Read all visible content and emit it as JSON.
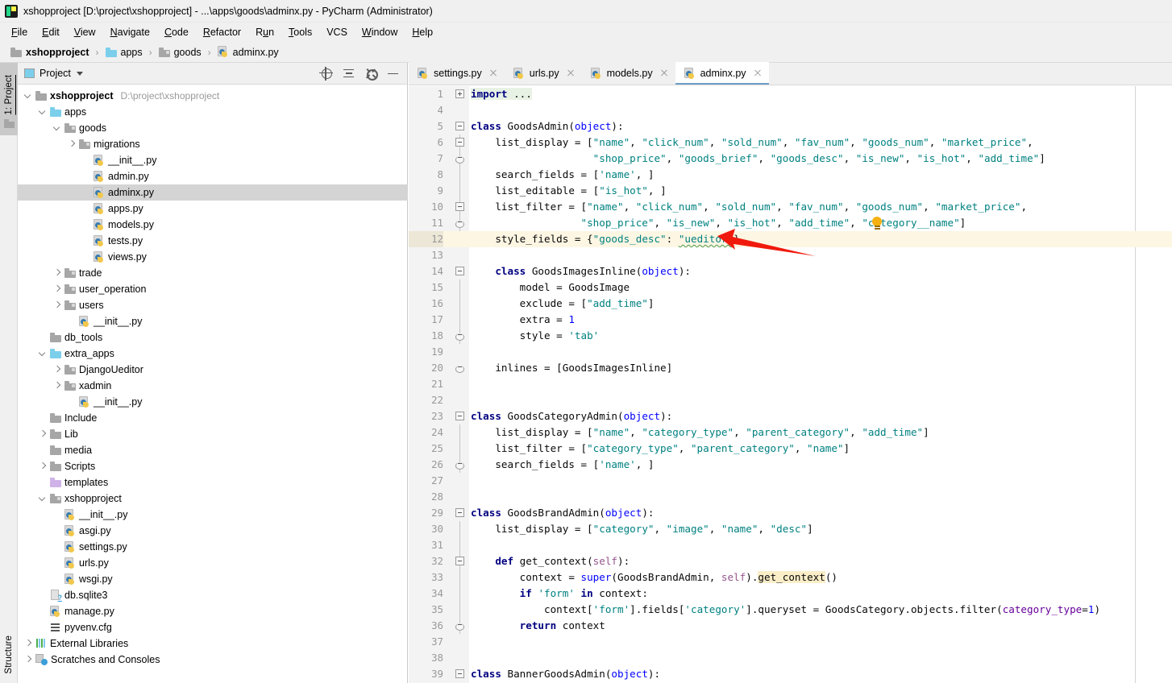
{
  "window": {
    "title": "xshopproject [D:\\project\\xshopproject] - ...\\apps\\goods\\adminx.py - PyCharm (Administrator)",
    "app_icon": "pycharm-logo-icon"
  },
  "menubar": {
    "items": [
      {
        "label": "File",
        "mnemonic": "F"
      },
      {
        "label": "Edit",
        "mnemonic": "E"
      },
      {
        "label": "View",
        "mnemonic": "V"
      },
      {
        "label": "Navigate",
        "mnemonic": "N"
      },
      {
        "label": "Code",
        "mnemonic": "C"
      },
      {
        "label": "Refactor",
        "mnemonic": "R"
      },
      {
        "label": "Run",
        "mnemonic": "u"
      },
      {
        "label": "Tools",
        "mnemonic": "T"
      },
      {
        "label": "VCS",
        "mnemonic": ""
      },
      {
        "label": "Window",
        "mnemonic": "W"
      },
      {
        "label": "Help",
        "mnemonic": "H"
      }
    ]
  },
  "breadcrumb": {
    "items": [
      {
        "label": "xshopproject",
        "icon": "folder-icon",
        "bold": true
      },
      {
        "label": "apps",
        "icon": "folder-blue-icon",
        "bold": false
      },
      {
        "label": "goods",
        "icon": "folder-source-icon",
        "bold": false
      },
      {
        "label": "adminx.py",
        "icon": "python-file-icon",
        "bold": false
      }
    ],
    "separator": "›"
  },
  "left_toolstrip": {
    "project_tab": "1: Project",
    "structure_tab": "Structure"
  },
  "project_panel": {
    "title": "Project",
    "actions": [
      {
        "name": "select-opened-file-icon",
        "label": "Select Opened File"
      },
      {
        "name": "collapse-all-icon",
        "label": "Collapse All"
      },
      {
        "name": "settings-gear-icon",
        "label": "Settings"
      },
      {
        "name": "hide-panel-icon",
        "label": "Hide"
      }
    ],
    "tree": [
      {
        "indent": 0,
        "arrow": "down",
        "icon": "folder-icon",
        "label": "xshopproject",
        "bold": true,
        "sub": "D:\\project\\xshopproject",
        "selected": false
      },
      {
        "indent": 1,
        "arrow": "down",
        "icon": "folder-blue-icon",
        "label": "apps",
        "bold": false,
        "sub": "",
        "selected": false
      },
      {
        "indent": 2,
        "arrow": "down",
        "icon": "folder-source-icon",
        "label": "goods",
        "bold": false,
        "sub": "",
        "selected": false
      },
      {
        "indent": 3,
        "arrow": "right",
        "icon": "folder-source-icon",
        "label": "migrations",
        "bold": false,
        "sub": "",
        "selected": false
      },
      {
        "indent": 4,
        "arrow": "none",
        "icon": "python-file-icon",
        "label": "__init__.py",
        "bold": false,
        "sub": "",
        "selected": false
      },
      {
        "indent": 4,
        "arrow": "none",
        "icon": "python-file-icon",
        "label": "admin.py",
        "bold": false,
        "sub": "",
        "selected": false
      },
      {
        "indent": 4,
        "arrow": "none",
        "icon": "python-file-icon",
        "label": "adminx.py",
        "bold": false,
        "sub": "",
        "selected": true
      },
      {
        "indent": 4,
        "arrow": "none",
        "icon": "python-file-icon",
        "label": "apps.py",
        "bold": false,
        "sub": "",
        "selected": false
      },
      {
        "indent": 4,
        "arrow": "none",
        "icon": "python-file-icon",
        "label": "models.py",
        "bold": false,
        "sub": "",
        "selected": false
      },
      {
        "indent": 4,
        "arrow": "none",
        "icon": "python-file-icon",
        "label": "tests.py",
        "bold": false,
        "sub": "",
        "selected": false
      },
      {
        "indent": 4,
        "arrow": "none",
        "icon": "python-file-icon",
        "label": "views.py",
        "bold": false,
        "sub": "",
        "selected": false
      },
      {
        "indent": 2,
        "arrow": "right",
        "icon": "folder-source-icon",
        "label": "trade",
        "bold": false,
        "sub": "",
        "selected": false
      },
      {
        "indent": 2,
        "arrow": "right",
        "icon": "folder-source-icon",
        "label": "user_operation",
        "bold": false,
        "sub": "",
        "selected": false
      },
      {
        "indent": 2,
        "arrow": "right",
        "icon": "folder-source-icon",
        "label": "users",
        "bold": false,
        "sub": "",
        "selected": false
      },
      {
        "indent": 3,
        "arrow": "none",
        "icon": "python-file-icon",
        "label": "__init__.py",
        "bold": false,
        "sub": "",
        "selected": false
      },
      {
        "indent": 1,
        "arrow": "none",
        "icon": "folder-icon",
        "label": "db_tools",
        "bold": false,
        "sub": "",
        "selected": false
      },
      {
        "indent": 1,
        "arrow": "down",
        "icon": "folder-blue-icon",
        "label": "extra_apps",
        "bold": false,
        "sub": "",
        "selected": false
      },
      {
        "indent": 2,
        "arrow": "right",
        "icon": "folder-source-icon",
        "label": "DjangoUeditor",
        "bold": false,
        "sub": "",
        "selected": false
      },
      {
        "indent": 2,
        "arrow": "right",
        "icon": "folder-source-icon",
        "label": "xadmin",
        "bold": false,
        "sub": "",
        "selected": false
      },
      {
        "indent": 3,
        "arrow": "none",
        "icon": "python-file-icon",
        "label": "__init__.py",
        "bold": false,
        "sub": "",
        "selected": false
      },
      {
        "indent": 1,
        "arrow": "none",
        "icon": "folder-icon",
        "label": "Include",
        "bold": false,
        "sub": "",
        "selected": false
      },
      {
        "indent": 1,
        "arrow": "right",
        "icon": "folder-icon",
        "label": "Lib",
        "bold": false,
        "sub": "",
        "selected": false
      },
      {
        "indent": 1,
        "arrow": "none",
        "icon": "folder-icon",
        "label": "media",
        "bold": false,
        "sub": "",
        "selected": false
      },
      {
        "indent": 1,
        "arrow": "right",
        "icon": "folder-icon",
        "label": "Scripts",
        "bold": false,
        "sub": "",
        "selected": false
      },
      {
        "indent": 1,
        "arrow": "none",
        "icon": "folder-purple-icon",
        "label": "templates",
        "bold": false,
        "sub": "",
        "selected": false
      },
      {
        "indent": 1,
        "arrow": "down",
        "icon": "folder-source-icon",
        "label": "xshopproject",
        "bold": false,
        "sub": "",
        "selected": false
      },
      {
        "indent": 2,
        "arrow": "none",
        "icon": "python-file-icon",
        "label": "__init__.py",
        "bold": false,
        "sub": "",
        "selected": false
      },
      {
        "indent": 2,
        "arrow": "none",
        "icon": "python-file-icon",
        "label": "asgi.py",
        "bold": false,
        "sub": "",
        "selected": false
      },
      {
        "indent": 2,
        "arrow": "none",
        "icon": "python-file-icon",
        "label": "settings.py",
        "bold": false,
        "sub": "",
        "selected": false
      },
      {
        "indent": 2,
        "arrow": "none",
        "icon": "python-file-icon",
        "label": "urls.py",
        "bold": false,
        "sub": "",
        "selected": false
      },
      {
        "indent": 2,
        "arrow": "none",
        "icon": "python-file-icon",
        "label": "wsgi.py",
        "bold": false,
        "sub": "",
        "selected": false
      },
      {
        "indent": 1,
        "arrow": "none",
        "icon": "sqlite-file-icon",
        "label": "db.sqlite3",
        "bold": false,
        "sub": "",
        "selected": false
      },
      {
        "indent": 1,
        "arrow": "none",
        "icon": "python-file-icon",
        "label": "manage.py",
        "bold": false,
        "sub": "",
        "selected": false
      },
      {
        "indent": 1,
        "arrow": "none",
        "icon": "config-file-icon",
        "label": "pyvenv.cfg",
        "bold": false,
        "sub": "",
        "selected": false
      },
      {
        "indent": 0,
        "arrow": "right",
        "icon": "libraries-icon",
        "label": "External Libraries",
        "bold": false,
        "sub": "",
        "selected": false
      },
      {
        "indent": 0,
        "arrow": "right",
        "icon": "scratches-icon",
        "label": "Scratches and Consoles",
        "bold": false,
        "sub": "",
        "selected": false
      }
    ]
  },
  "editor": {
    "tabs": [
      {
        "label": "settings.py",
        "active": false,
        "icon": "python-file-icon"
      },
      {
        "label": "urls.py",
        "active": false,
        "icon": "python-file-icon"
      },
      {
        "label": "models.py",
        "active": false,
        "icon": "python-file-icon"
      },
      {
        "label": "adminx.py",
        "active": true,
        "icon": "python-file-icon"
      }
    ],
    "annotation": {
      "type": "red-arrow",
      "color": "#f01a0c",
      "points_to_line": 12
    },
    "lines": [
      {
        "num": "1",
        "fold": "plus",
        "guide": false,
        "bulb": false,
        "hl": false,
        "html": "<span class=\"importline\"><span class=\"imp\">import</span> ...</span>"
      },
      {
        "num": "4",
        "fold": "",
        "guide": false,
        "bulb": false,
        "hl": false,
        "html": ""
      },
      {
        "num": "5",
        "fold": "minus",
        "guide": false,
        "bulb": false,
        "hl": false,
        "html": "<span class=\"kw\">class</span> GoodsAdmin(<span class=\"blt\">object</span>):"
      },
      {
        "num": "6",
        "fold": "minus",
        "guide": true,
        "bulb": false,
        "hl": false,
        "html": "    list_display = [<span class=\"str\">\"name\"</span>, <span class=\"str\">\"click_num\"</span>, <span class=\"str\">\"sold_num\"</span>, <span class=\"str\">\"fav_num\"</span>, <span class=\"str\">\"goods_num\"</span>, <span class=\"str\">\"market_price\"</span>,"
      },
      {
        "num": "7",
        "fold": "cap",
        "guide": true,
        "bulb": false,
        "hl": false,
        "html": "                    <span class=\"str\">\"shop_price\"</span>, <span class=\"str\">\"goods_brief\"</span>, <span class=\"str\">\"goods_desc\"</span>, <span class=\"str\">\"is_new\"</span>, <span class=\"str\">\"is_hot\"</span>, <span class=\"str\">\"add_time\"</span>]"
      },
      {
        "num": "8",
        "fold": "",
        "guide": true,
        "bulb": false,
        "hl": false,
        "html": "    search_fields = [<span class=\"str\">'name'</span>, ]"
      },
      {
        "num": "9",
        "fold": "",
        "guide": true,
        "bulb": false,
        "hl": false,
        "html": "    list_editable = [<span class=\"str\">\"is_hot\"</span>, ]"
      },
      {
        "num": "10",
        "fold": "minus",
        "guide": true,
        "bulb": false,
        "hl": false,
        "html": "    list_filter = [<span class=\"str\">\"name\"</span>, <span class=\"str\">\"click_num\"</span>, <span class=\"str\">\"sold_num\"</span>, <span class=\"str\">\"fav_num\"</span>, <span class=\"str\">\"goods_num\"</span>, <span class=\"str\">\"market_price\"</span>,"
      },
      {
        "num": "11",
        "fold": "cap",
        "guide": true,
        "bulb": true,
        "hl": false,
        "html": "                  <span class=\"str\">\"shop_price\"</span>, <span class=\"str\">\"is_new\"</span>, <span class=\"str\">\"is_hot\"</span>, <span class=\"str\">\"add_time\"</span>, <span class=\"str\">\"category__name\"</span>]"
      },
      {
        "num": "12",
        "fold": "",
        "guide": false,
        "bulb": false,
        "hl": true,
        "html": "    style_fields = {<span class=\"str\">\"goods_desc\"</span>: <span class=\"str squiggly\">\"ueditor\"</span>}"
      },
      {
        "num": "13",
        "fold": "",
        "guide": false,
        "bulb": false,
        "hl": false,
        "html": ""
      },
      {
        "num": "14",
        "fold": "minus",
        "guide": false,
        "bulb": false,
        "hl": false,
        "html": "    <span class=\"kw\">class</span> GoodsImagesInline(<span class=\"blt\">object</span>):"
      },
      {
        "num": "15",
        "fold": "",
        "guide": true,
        "bulb": false,
        "hl": false,
        "html": "        model = GoodsImage"
      },
      {
        "num": "16",
        "fold": "",
        "guide": true,
        "bulb": false,
        "hl": false,
        "html": "        exclude = [<span class=\"str\">\"add_time\"</span>]"
      },
      {
        "num": "17",
        "fold": "",
        "guide": true,
        "bulb": false,
        "hl": false,
        "html": "        extra = <span class=\"num\">1</span>"
      },
      {
        "num": "18",
        "fold": "cap",
        "guide": true,
        "bulb": false,
        "hl": false,
        "html": "        style = <span class=\"str\">'tab'</span>"
      },
      {
        "num": "19",
        "fold": "",
        "guide": false,
        "bulb": false,
        "hl": false,
        "html": ""
      },
      {
        "num": "20",
        "fold": "cap",
        "guide": false,
        "bulb": false,
        "hl": false,
        "html": "    inlines = [GoodsImagesInline]"
      },
      {
        "num": "21",
        "fold": "",
        "guide": false,
        "bulb": false,
        "hl": false,
        "html": ""
      },
      {
        "num": "22",
        "fold": "",
        "guide": false,
        "bulb": false,
        "hl": false,
        "html": ""
      },
      {
        "num": "23",
        "fold": "minus",
        "guide": false,
        "bulb": false,
        "hl": false,
        "html": "<span class=\"kw\">class</span> GoodsCategoryAdmin(<span class=\"blt\">object</span>):"
      },
      {
        "num": "24",
        "fold": "",
        "guide": true,
        "bulb": false,
        "hl": false,
        "html": "    list_display = [<span class=\"str\">\"name\"</span>, <span class=\"str\">\"category_type\"</span>, <span class=\"str\">\"parent_category\"</span>, <span class=\"str\">\"add_time\"</span>]"
      },
      {
        "num": "25",
        "fold": "",
        "guide": true,
        "bulb": false,
        "hl": false,
        "html": "    list_filter = [<span class=\"str\">\"category_type\"</span>, <span class=\"str\">\"parent_category\"</span>, <span class=\"str\">\"name\"</span>]"
      },
      {
        "num": "26",
        "fold": "cap",
        "guide": true,
        "bulb": false,
        "hl": false,
        "html": "    search_fields = [<span class=\"str\">'name'</span>, ]"
      },
      {
        "num": "27",
        "fold": "",
        "guide": false,
        "bulb": false,
        "hl": false,
        "html": ""
      },
      {
        "num": "28",
        "fold": "",
        "guide": false,
        "bulb": false,
        "hl": false,
        "html": ""
      },
      {
        "num": "29",
        "fold": "minus",
        "guide": false,
        "bulb": false,
        "hl": false,
        "html": "<span class=\"kw\">class</span> GoodsBrandAdmin(<span class=\"blt\">object</span>):"
      },
      {
        "num": "30",
        "fold": "",
        "guide": true,
        "bulb": false,
        "hl": false,
        "html": "    list_display = [<span class=\"str\">\"category\"</span>, <span class=\"str\">\"image\"</span>, <span class=\"str\">\"name\"</span>, <span class=\"str\">\"desc\"</span>]"
      },
      {
        "num": "31",
        "fold": "",
        "guide": true,
        "bulb": false,
        "hl": false,
        "html": ""
      },
      {
        "num": "32",
        "fold": "minus",
        "guide": true,
        "bulb": false,
        "hl": false,
        "html": "    <span class=\"kw\">def</span> get_context(<span class=\"self\">self</span>):"
      },
      {
        "num": "33",
        "fold": "",
        "guide": true,
        "bulb": false,
        "hl": false,
        "html": "        context = <span class=\"blt\">super</span>(GoodsBrandAdmin, <span class=\"self\">self</span>).<span class=\"hlword\">get_context</span>()"
      },
      {
        "num": "34",
        "fold": "",
        "guide": true,
        "bulb": false,
        "hl": false,
        "html": "        <span class=\"kw\">if</span> <span class=\"str\">'form'</span> <span class=\"kw\">in</span> context:"
      },
      {
        "num": "35",
        "fold": "",
        "guide": true,
        "bulb": false,
        "hl": false,
        "html": "            context[<span class=\"str\">'form'</span>].fields[<span class=\"str\">'category'</span>].queryset = GoodsCategory.objects.filter(<span class=\"par\">category_type</span>=<span class=\"num\">1</span>)"
      },
      {
        "num": "36",
        "fold": "cap",
        "guide": true,
        "bulb": false,
        "hl": false,
        "html": "        <span class=\"kw\">return</span> context"
      },
      {
        "num": "37",
        "fold": "",
        "guide": false,
        "bulb": false,
        "hl": false,
        "html": ""
      },
      {
        "num": "38",
        "fold": "",
        "guide": false,
        "bulb": false,
        "hl": false,
        "html": ""
      },
      {
        "num": "39",
        "fold": "minus",
        "guide": false,
        "bulb": false,
        "hl": false,
        "html": "<span class=\"kw\">class</span> BannerGoodsAdmin(<span class=\"blt\">object</span>):"
      }
    ]
  }
}
